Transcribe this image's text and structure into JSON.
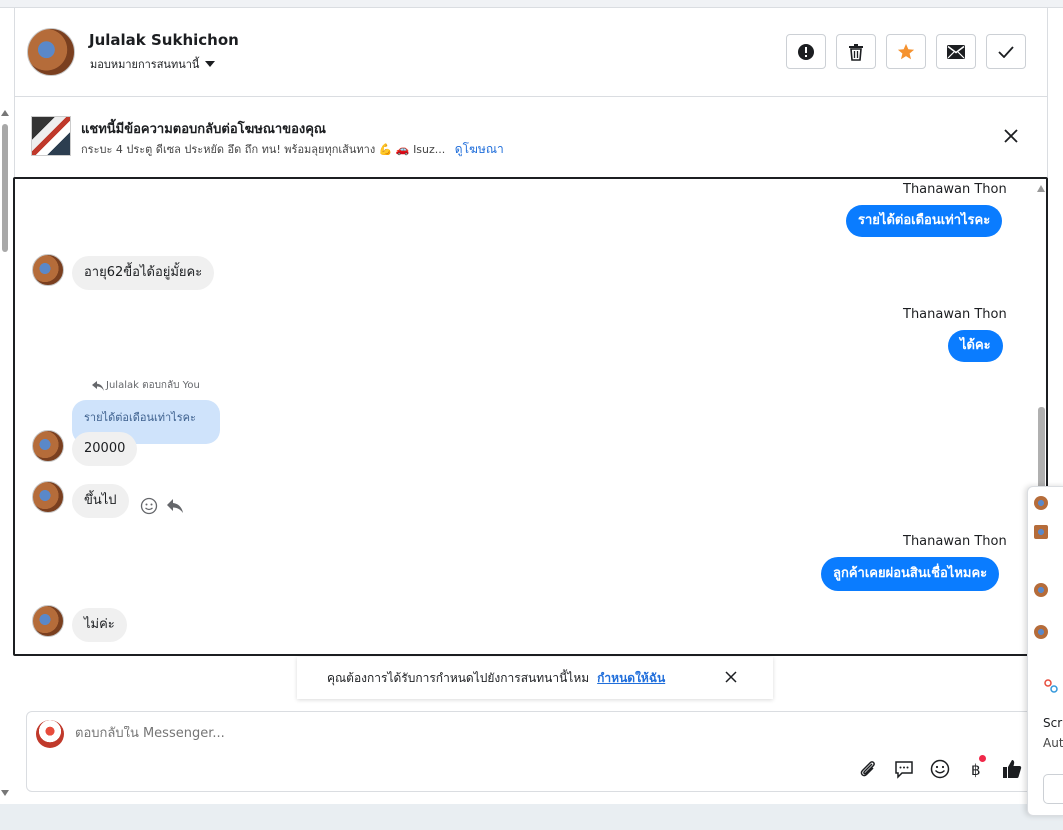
{
  "header": {
    "contact_name": "Julalak Sukhichon",
    "assign_label": "มอบหมายการสนทนานี้",
    "actions": [
      {
        "name": "spam",
        "icon": "exclamation-icon"
      },
      {
        "name": "delete",
        "icon": "trash-icon"
      },
      {
        "name": "star",
        "icon": "star-icon"
      },
      {
        "name": "mark-unread",
        "icon": "envelope-icon"
      },
      {
        "name": "done",
        "icon": "check-icon"
      }
    ]
  },
  "ad_notice": {
    "title": "แชทนี้มีข้อความตอบกลับต่อโฆษณาของคุณ",
    "subtitle": "กระบะ 4 ประตู ดีเซล ประหยัด อึด ถึก ทน! พร้อมลุยทุกเส้นทาง 💪 🚗 Isuz...",
    "link": "ดูโฆษณา"
  },
  "messages": {
    "sender_name": "Thanawan Thon",
    "m1": "รายได้ต่อเดือนเท่าไรคะ",
    "m2": "อายุ62ขื้อได้อยู่มั้ยคะ",
    "m3": "ได้คะ",
    "reply_label": "Julalak ตอบกลับ You",
    "quoted": "รายได้ต่อเดือนเท่าไรคะ",
    "m4": "20000",
    "m5": "ขึ้นไป",
    "m6": "ลูกค้าเคยผ่อนสินเชื่อไหมคะ",
    "m7": "ไม่ค่ะ"
  },
  "assign_prompt": {
    "text": "คุณต้องการได้รับการกำหนดไปยังการสนทนานี้ไหม",
    "link": "กำหนดให้ฉัน"
  },
  "composer": {
    "placeholder": "ตอบกลับใน Messenger...",
    "tools": [
      "paperclip-icon",
      "saved-reply-icon",
      "emoji-icon",
      "baht-icon",
      "thumbs-up-icon"
    ]
  },
  "popup": {
    "line1": "Scr",
    "line2": "Aut"
  },
  "colors": {
    "accent": "#0a7cff",
    "star": "#f5922f",
    "link": "#216fdb"
  }
}
